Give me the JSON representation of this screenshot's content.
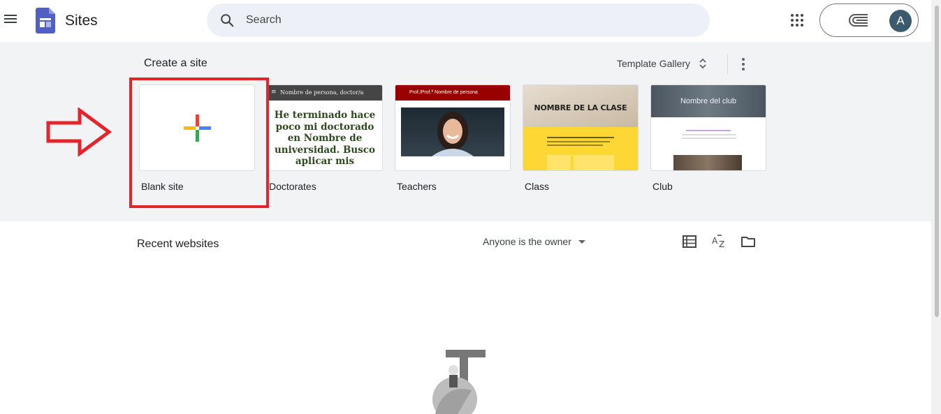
{
  "header": {
    "app_title": "Sites",
    "search_placeholder": "Search",
    "menu_icon": "hamburger-menu-icon",
    "apps_icon": "apps-grid-icon",
    "avatar_initial": "A"
  },
  "create": {
    "title": "Create a site",
    "template_gallery_label": "Template Gallery",
    "templates": [
      {
        "label": "Blank site"
      },
      {
        "label": "Doctorates",
        "bar_text": "Nombre de persona, doctor/a",
        "body_text": "He terminado hace poco mi doctorado en Nombre de universidad. Busco aplicar mis"
      },
      {
        "label": "Teachers",
        "bar_text": "Prof./Prof.ª Nombre de persona"
      },
      {
        "label": "Class",
        "hero_text": "NOMBRE DE LA CLASE"
      },
      {
        "label": "Club",
        "hero_text": "Nombre del club"
      }
    ]
  },
  "recent": {
    "title": "Recent websites",
    "owner_filter_label": "Anyone is the owner"
  },
  "colors": {
    "accent_red": "#e3242b",
    "panel_bg": "#f1f3f4",
    "search_bg": "#edf1f7"
  }
}
